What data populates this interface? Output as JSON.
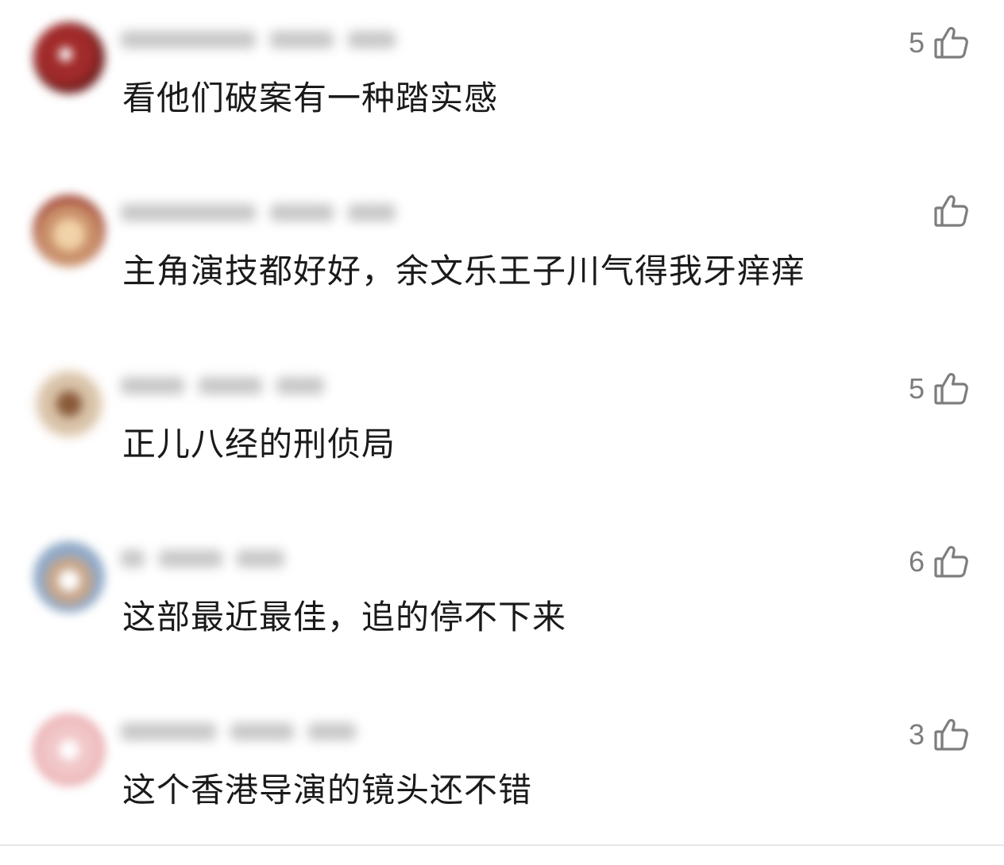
{
  "comments": [
    {
      "text": "看他们破案有一种踏实感",
      "likes": "5",
      "avatar_color": "#a12a2a"
    },
    {
      "text": "主角演技都好好，余文乐王子川气得我牙痒痒",
      "likes": "",
      "avatar_color": "#c9906a"
    },
    {
      "text": "正儿八经的刑侦局",
      "likes": "5",
      "avatar_color": "#b89070"
    },
    {
      "text": "这部最近最佳，追的停不下来",
      "likes": "6",
      "avatar_color": "#8fa9c8"
    },
    {
      "text": "这个香港导演的镜头还不错",
      "likes": "3",
      "avatar_color": "#e8b4b8"
    }
  ],
  "icons": {
    "like": "thumbs-up-icon"
  },
  "colors": {
    "text": "#1a1a1a",
    "like": "#7d7d7d"
  }
}
